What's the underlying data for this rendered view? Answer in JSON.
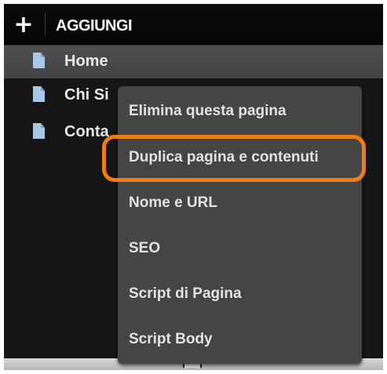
{
  "header": {
    "add_icon": "plus-icon",
    "add_glyph": "+",
    "add_label": "AGGIUNGI"
  },
  "pages": [
    {
      "label": "Home",
      "active": true,
      "icon": "page-icon"
    },
    {
      "label": "Chi Si",
      "active": false,
      "icon": "page-icon"
    },
    {
      "label": "Conta",
      "active": false,
      "icon": "page-icon"
    }
  ],
  "context_menu": {
    "items": [
      "Elimina questa pagina",
      "Duplica pagina e contenuti",
      "Nome e URL",
      "SEO",
      "Script di Pagina",
      "Script Body"
    ],
    "highlighted_item": "Duplica pagina e contenuti",
    "highlight_color": "#f07d12"
  },
  "colors": {
    "panel_bg": "#161616",
    "active_row_bg": "#4a4a4a",
    "menu_bg": "#454545",
    "page_icon": "#a9c7e6"
  }
}
